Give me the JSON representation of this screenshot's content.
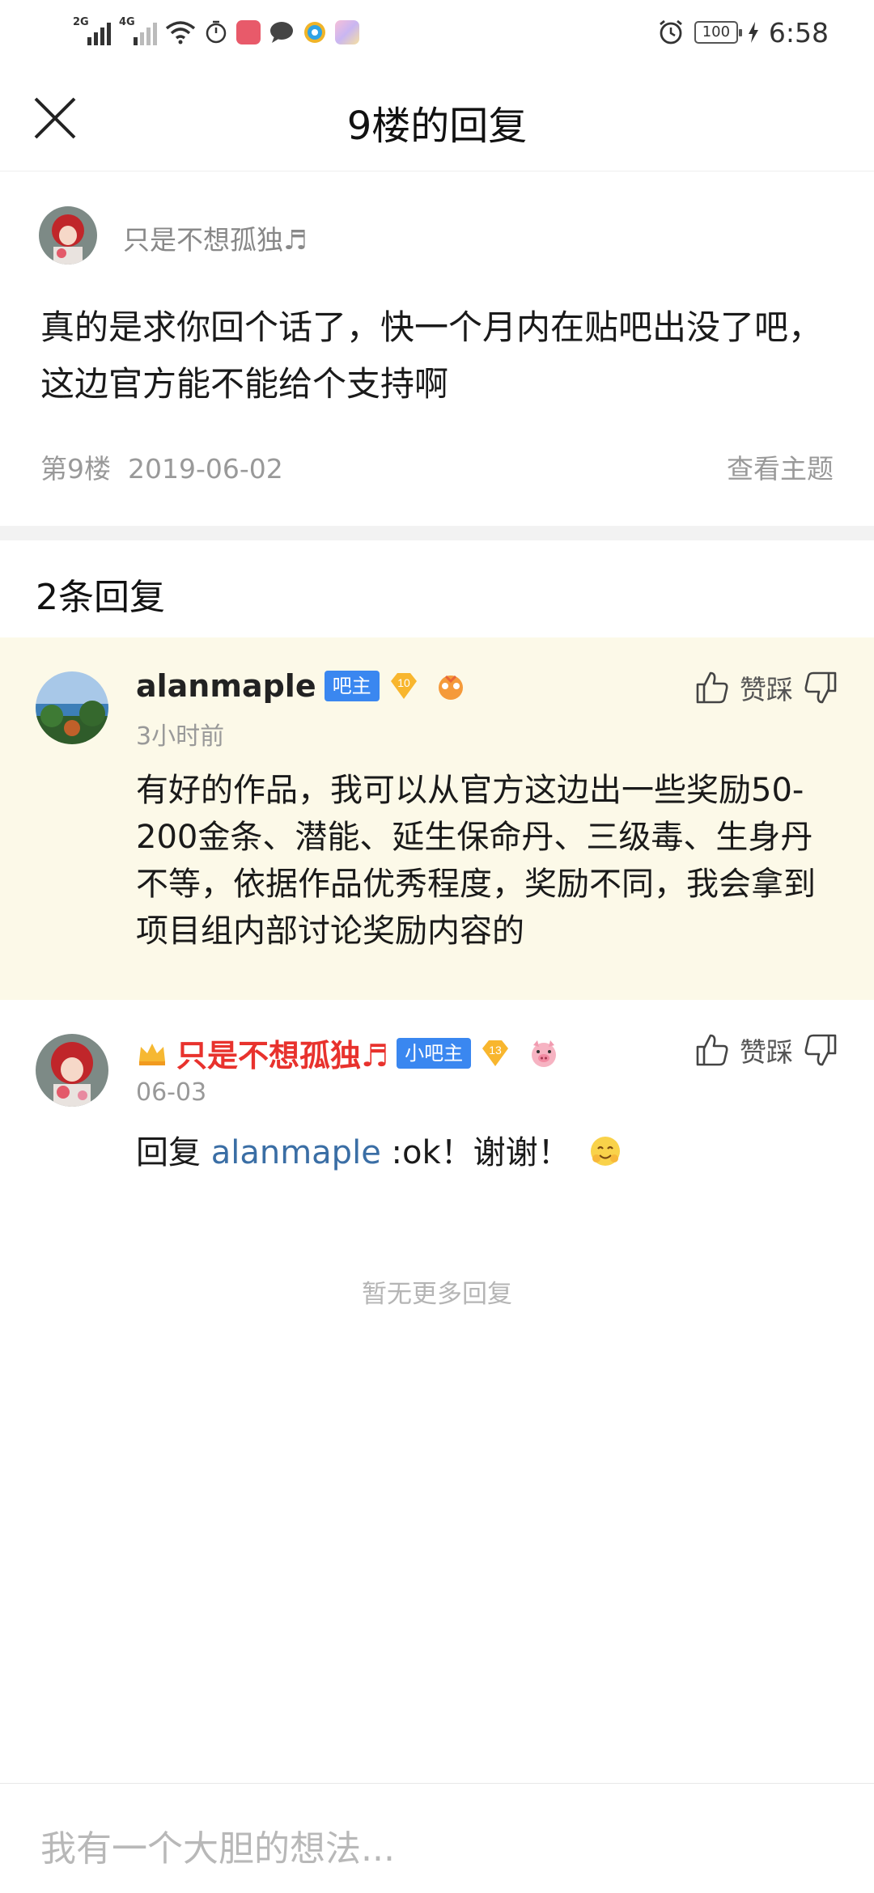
{
  "status_bar": {
    "network_1": "2G",
    "network_2": "4G",
    "battery": "100",
    "time": "6:58"
  },
  "header": {
    "title": "9楼的回复"
  },
  "main_post": {
    "username": "只是不想孤独♬",
    "content": "真的是求你回个话了，快一个月内在贴吧出没了吧，这边官方能不能给个支持啊",
    "floor": "第9楼",
    "date": "2019-06-02",
    "view_topic": "查看主题"
  },
  "reply_count": "2条回复",
  "replies": [
    {
      "username": "alanmaple",
      "badge": "吧主",
      "level": "10",
      "time": "3小时前",
      "content": "有好的作品，我可以从官方这边出一些奖励50-200金条、潜能、延生保命丹、三级毒、生身丹不等，依据作品优秀程度，奖励不同，我会拿到项目组内部讨论奖励内容的",
      "vote_label": "赞踩"
    },
    {
      "username": "只是不想孤独♬",
      "badge": "小吧主",
      "level": "13",
      "time": "06-03",
      "reply_prefix": "回复",
      "reply_mention": "alanmaple",
      "reply_text": " :ok！谢谢！",
      "vote_label": "赞踩"
    }
  ],
  "no_more": "暂无更多回复",
  "input_placeholder": "我有一个大胆的想法..."
}
